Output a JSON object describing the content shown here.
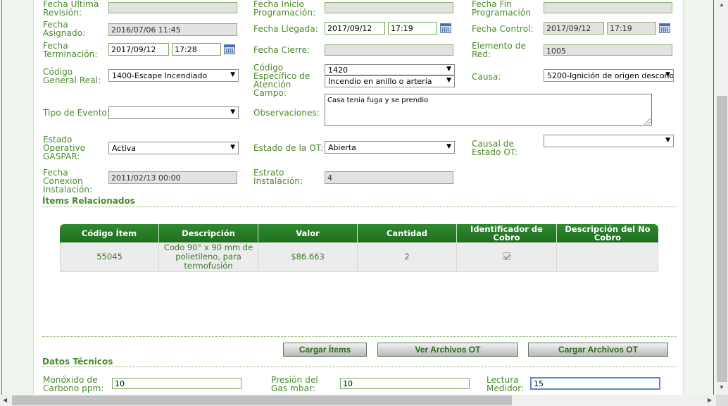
{
  "form": {
    "fecha_ultima_revision": {
      "label": "Fecha Ultima Revisión:",
      "value": ""
    },
    "fecha_inicio_programacion": {
      "label": "Fecha Inicio Programación:",
      "value": ""
    },
    "fecha_fin_programacion": {
      "label": "Fecha Fin Programación",
      "value": ""
    },
    "fecha_asignado": {
      "label": "Fecha Asignado:",
      "value": "2016/07/06 11:45"
    },
    "fecha_llegada": {
      "label": "Fecha Llegada:",
      "date": "2017/09/12",
      "time": "17:19"
    },
    "fecha_control": {
      "label": "Fecha Control:",
      "date": "2017/09/12",
      "time": "17:19"
    },
    "fecha_terminacion": {
      "label": "Fecha Terminación:",
      "date": "2017/09/12",
      "time": "17:28"
    },
    "fecha_cierre": {
      "label": "Fecha Cierre:",
      "value": ""
    },
    "elemento_red": {
      "label": "Elemento de Red:",
      "value": "1005"
    },
    "codigo_general": {
      "label": "Código General Real:",
      "value": "1400-Escape Incendiado"
    },
    "codigo_especifico": {
      "label": "Código Específico de Atención Campo:",
      "value1": "1420",
      "value2": "Incendio en anillo o artería"
    },
    "causa": {
      "label": "Causa:",
      "value": "5200-Ignición de origen descono"
    },
    "tipo_evento": {
      "label": "Tipo de Evento:",
      "value": ""
    },
    "observaciones": {
      "label": "Observaciones:",
      "value": "Casa tenia fuga y se prendio"
    },
    "estado_operativo": {
      "label": "Estado Operativo GASPAR:",
      "value": "Activa"
    },
    "estado_ot": {
      "label": "Estado de la OT:",
      "value": "Abierta"
    },
    "causal_estado": {
      "label": "Causal de Estado OT:",
      "value": ""
    },
    "fecha_conexion": {
      "label": "Fecha Conexion Instalación:",
      "value": "2011/02/13 00:00"
    },
    "estrato": {
      "label": "Estrato Instalación:",
      "value": "4"
    }
  },
  "items_section": {
    "title": "Ítems Relacionados",
    "columns": [
      "Código Ítem",
      "Descripción",
      "Valor",
      "Cantidad",
      "Identificador de Cobro",
      "Descripción del No Cobro"
    ],
    "rows": [
      {
        "codigo": "55045",
        "descripcion": "Codo 90° x 90 mm de polietileno, para termofusión",
        "valor": "$86.663",
        "cantidad": "2",
        "identificador_cobro": true,
        "desc_no_cobro": ""
      }
    ]
  },
  "buttons": {
    "cargar_items": "Cargar Ítems",
    "ver_archivos": "Ver Archivos OT",
    "cargar_archivos": "Cargar Archivos OT"
  },
  "datos_tecnicos": {
    "title": "Datos Técnicos",
    "monoxido": {
      "label": "Monóxido de Carbono ppm:",
      "value": "10"
    },
    "presion": {
      "label": "Presión del Gas mbar:",
      "value": "10"
    },
    "lectura": {
      "label": "Lectura Medidor:",
      "value": "15"
    }
  },
  "icons": {
    "calendar": "calendar-icon",
    "dropdown": "chevron-down-icon"
  }
}
